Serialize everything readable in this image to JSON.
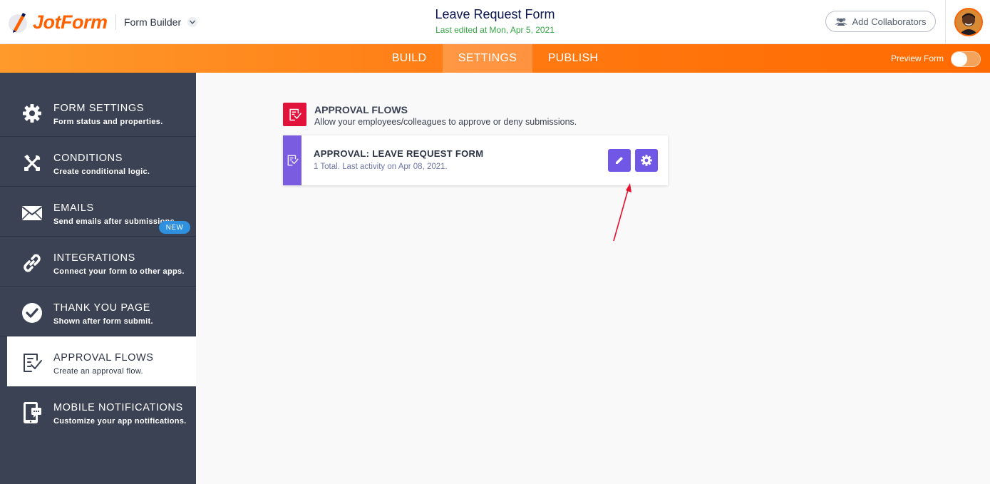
{
  "header": {
    "logo_text": "JotForm",
    "builder_label": "Form Builder",
    "form_title": "Leave Request Form",
    "last_edited": "Last edited at Mon, Apr 5, 2021",
    "collaborators_label": "Add Collaborators"
  },
  "nav": {
    "tabs": [
      {
        "label": "BUILD",
        "active": false
      },
      {
        "label": "SETTINGS",
        "active": true
      },
      {
        "label": "PUBLISH",
        "active": false
      }
    ],
    "preview_label": "Preview Form",
    "preview_on": false
  },
  "sidebar": {
    "items": [
      {
        "title": "FORM SETTINGS",
        "subtitle": "Form status and properties.",
        "icon": "gear-icon"
      },
      {
        "title": "CONDITIONS",
        "subtitle": "Create conditional logic.",
        "icon": "tools-icon"
      },
      {
        "title": "EMAILS",
        "subtitle": "Send emails after submissions.",
        "icon": "envelope-icon"
      },
      {
        "title": "INTEGRATIONS",
        "subtitle": "Connect your form to other apps.",
        "icon": "link-icon"
      },
      {
        "title": "THANK YOU PAGE",
        "subtitle": "Shown after form submit.",
        "icon": "checkmark-icon"
      },
      {
        "title": "APPROVAL FLOWS",
        "subtitle": "Create an approval flow.",
        "icon": "approval-icon",
        "active": true
      },
      {
        "title": "MOBILE NOTIFICATIONS",
        "subtitle": "Customize your app notifications.",
        "icon": "mobile-notification-icon"
      }
    ],
    "new_badge": "NEW"
  },
  "main": {
    "section_title": "APPROVAL FLOWS",
    "section_desc": "Allow your employees/colleagues to approve or deny submissions.",
    "flow": {
      "title": "APPROVAL: LEAVE REQUEST FORM",
      "subtitle": "1 Total. Last activity on Apr 08, 2021."
    }
  },
  "colors": {
    "brand_orange": "#ff6100",
    "sidebar_bg": "#3a4253",
    "accent_purple": "#7057e6",
    "section_red": "#e2133b",
    "success_green": "#34a544",
    "badge_blue": "#2e90de",
    "annotation_red": "#e8102a"
  }
}
